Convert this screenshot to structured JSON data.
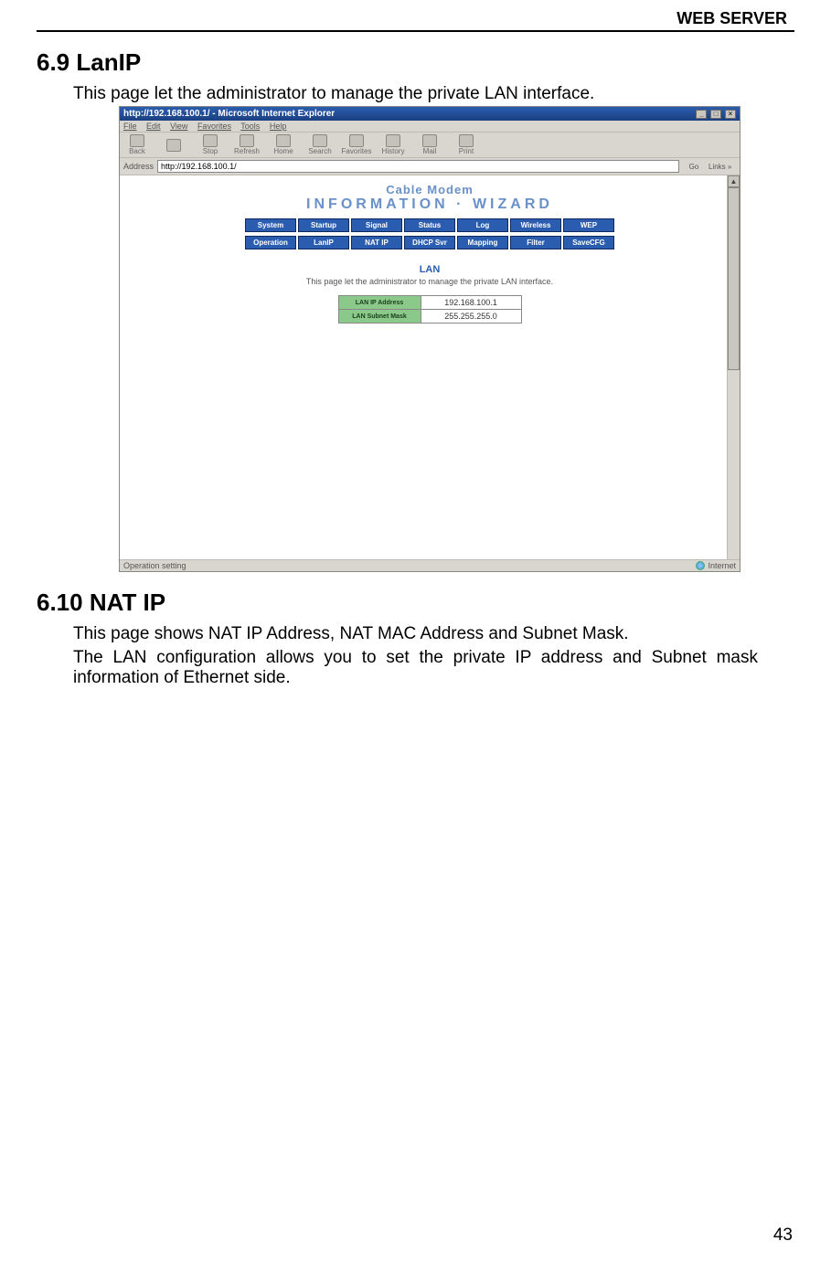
{
  "header": {
    "title": "WEB SERVER"
  },
  "sections": {
    "s1": {
      "heading": "6.9 LanIP",
      "intro": "This page let the administrator to manage the private LAN interface."
    },
    "s2": {
      "heading": "6.10 NAT IP",
      "p1": "This page shows NAT IP Address, NAT MAC Address and Subnet Mask.",
      "p2": "The LAN configuration allows you to set the private IP address and Subnet mask information of Ethernet side."
    }
  },
  "page_number": "43",
  "screenshot": {
    "window_title": "http://192.168.100.1/ - Microsoft Internet Explorer",
    "menu": [
      "File",
      "Edit",
      "View",
      "Favorites",
      "Tools",
      "Help"
    ],
    "toolbar": [
      "Back",
      "",
      "Stop",
      "Refresh",
      "Home",
      "Search",
      "Favorites",
      "History",
      "Mail",
      "Print"
    ],
    "address_label": "Address",
    "address_value": "http://192.168.100.1/",
    "go_label": "Go",
    "links_label": "Links »",
    "brand_top": "Cable Modem",
    "brand_sub": "INFORMATION  ·  WIZARD",
    "tabs_row1": [
      "System",
      "Startup",
      "Signal",
      "Status",
      "Log",
      "Wireless",
      "WEP"
    ],
    "tabs_row2": [
      "Operation",
      "LanIP",
      "NAT IP",
      "DHCP Svr",
      "Mapping",
      "Filter",
      "SaveCFG"
    ],
    "lan_title": "LAN",
    "lan_desc": "This page let the administrator to manage the private LAN interface.",
    "lan_rows": [
      {
        "label": "LAN IP Address",
        "value": "192.168.100.1"
      },
      {
        "label": "LAN Subnet Mask",
        "value": "255.255.255.0"
      }
    ],
    "status_left": "Operation setting",
    "status_right": "Internet"
  }
}
